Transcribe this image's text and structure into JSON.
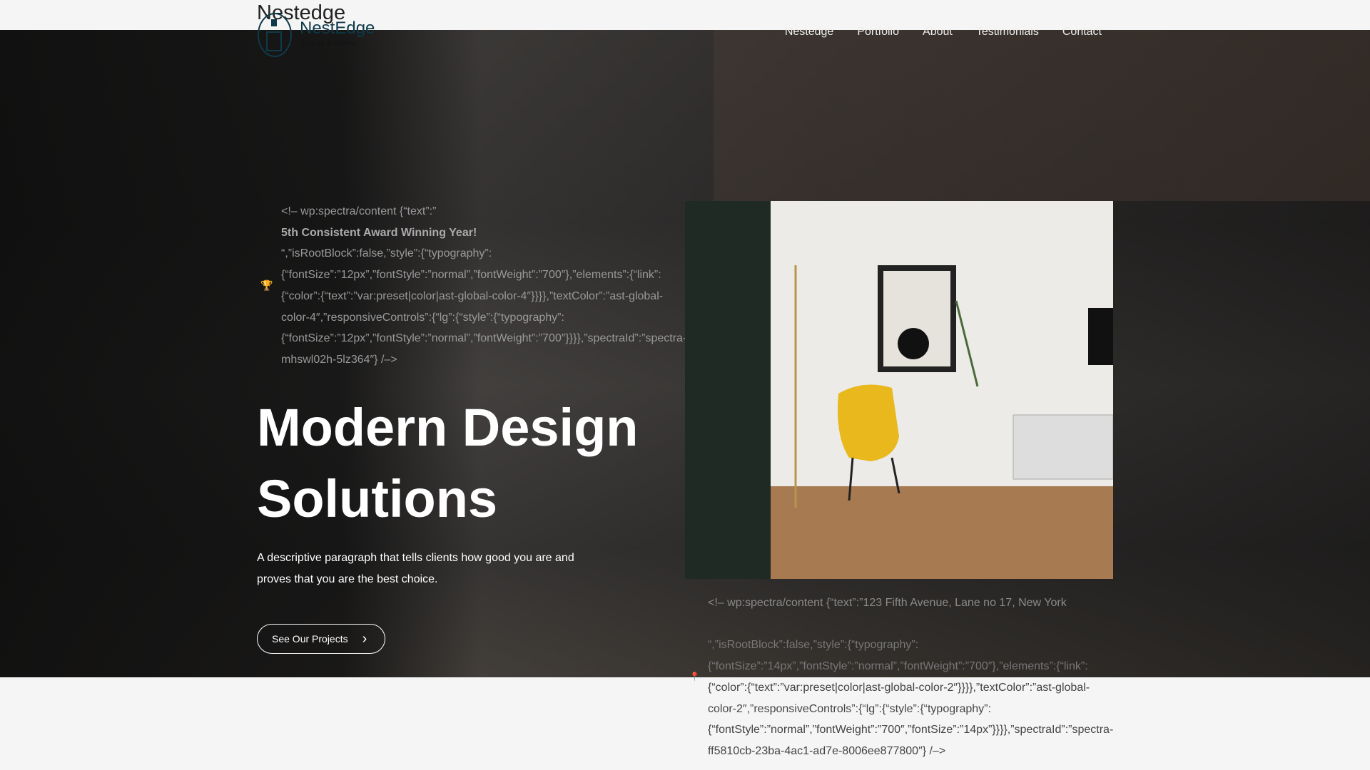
{
  "header": {
    "site_title": "Nestedge",
    "logo_text": "NestEdge",
    "logo_tagline": "Design & Interior",
    "nav": [
      "Nestedge",
      "Portfolio",
      "About",
      "Testimonials",
      "Contact"
    ]
  },
  "hero": {
    "badge_meta_lines": [
      "<!– wp:spectra/content {“text”:”",
      "5th Consistent Award Winning Year!",
      "“,”isRootBlock”:false,”style”:{“typography”:",
      "{“fontSize”:”12px”,”fontStyle”:”normal”,”fontWeight”:”700″},”elements”:{“link”:",
      "{“color”:{“text”:”var:preset|color|ast-global-color-4″}}}},”textColor”:”ast-global-",
      "color-4″,”responsiveControls”:{“lg”:{“style”:{“typography”:",
      "{“fontSize”:”12px”,”fontStyle”:”normal”,”fontWeight”:”700″}}}},”spectraId”:”spectra-",
      "mhswl02h-5lz364″} /–>"
    ],
    "heading_line1": "Modern Design",
    "heading_line2": "Solutions",
    "description": "A descriptive paragraph that tells clients how good you are and proves that you are the best choice.",
    "cta_label": "See Our Projects",
    "address_meta_lines": [
      "<!– wp:spectra/content {“text”:”123 Fifth Avenue, Lane no 17, New York",
      "“,”isRootBlock”:false,”style”:{“typography”:",
      "{“fontSize”:”14px”,”fontStyle”:”normal”,”fontWeight”:”700″},”elements”:{“link”:",
      "{“color”:{“text”:”var:preset|color|ast-global-color-2″}}}},”textColor”:”ast-global-",
      "color-2″,”responsiveControls”:{“lg”:{“style”:{“typography”:",
      "{“fontStyle”:”normal”,”fontWeight”:”700″,”fontSize”:”14px”}}}},”spectraId”:”spectra-",
      "ff5810cb-23ba-4ac1-ad7e-8006ee877800″} /–>"
    ]
  },
  "colors": {
    "accent": "#f0a030",
    "logo": "#0e3a4a"
  }
}
